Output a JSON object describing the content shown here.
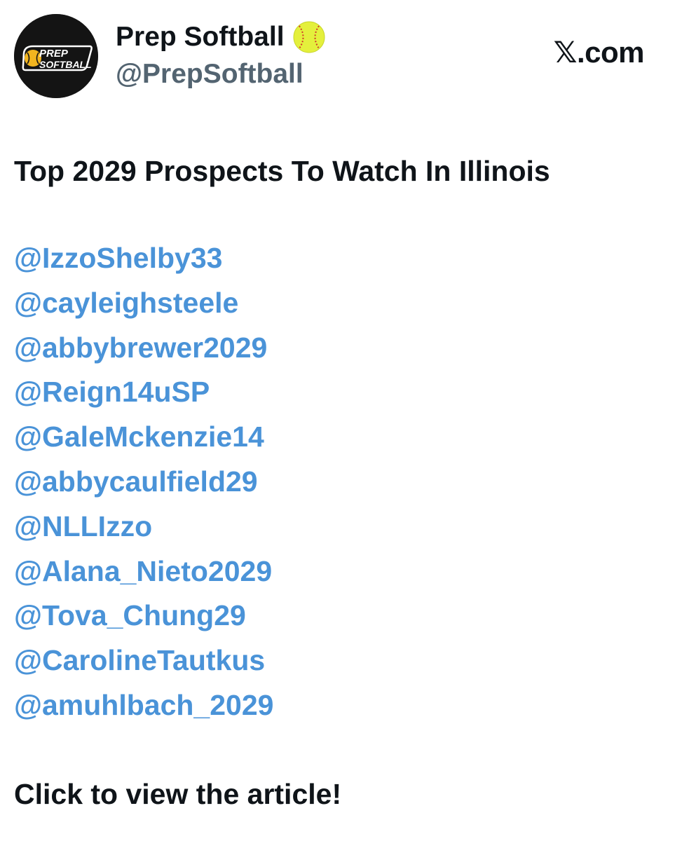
{
  "account": {
    "display_name": "Prep Softball",
    "handle": "@PrepSoftball",
    "avatar_text_top": "PREP",
    "avatar_text_bottom": "SOFTBALL",
    "name_emoji": "softball-icon"
  },
  "brand": {
    "label": ".com",
    "logo": "𝕏"
  },
  "post": {
    "title": "Top 2029 Prospects To Watch In Illinois",
    "mentions": [
      "@IzzoShelby33",
      "@cayleighsteele",
      "@abbybrewer2029",
      "@Reign14uSP",
      "@GaleMckenzie14",
      "@abbycaulfield29",
      "@NLLIzzo",
      "@Alana_Nieto2029",
      "@Tova_Chung29",
      "@CarolineTautkus",
      "@amuhlbach_2029"
    ],
    "cta": "Click to view the article!"
  },
  "colors": {
    "link": "#4a93d8",
    "text": "#0f1419",
    "muted": "#536471",
    "avatar_bg": "#141414",
    "softball": "#e4f03c"
  }
}
